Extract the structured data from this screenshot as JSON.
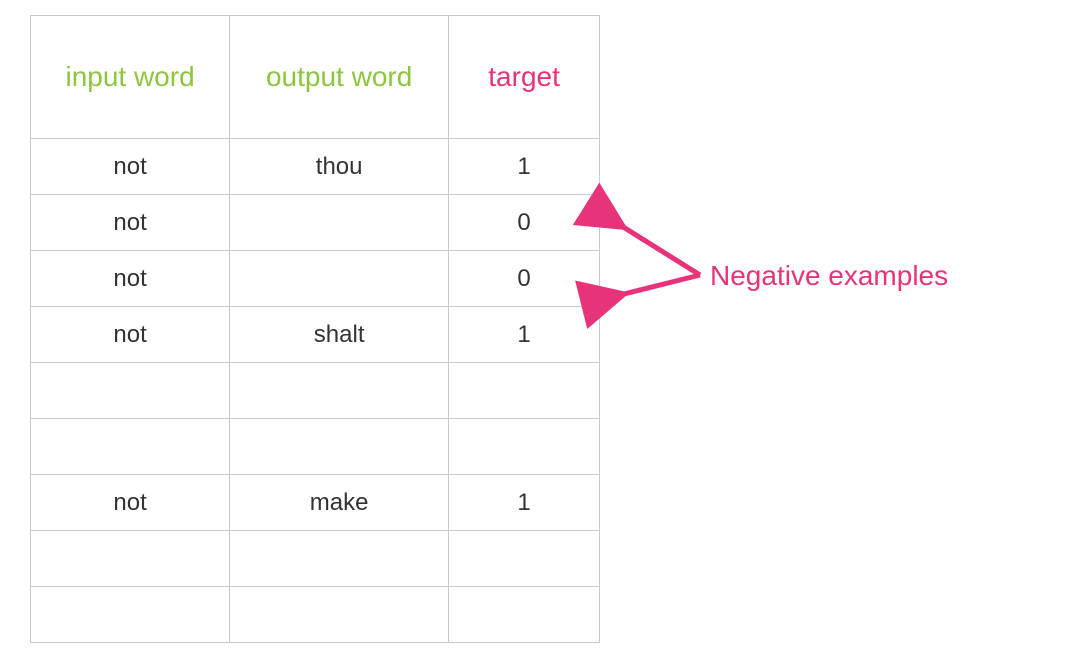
{
  "columns": {
    "input": "input word",
    "output": "output word",
    "target": "target"
  },
  "rows": [
    {
      "input": "not",
      "output": "thou",
      "target": "1"
    },
    {
      "input": "not",
      "output": "",
      "target": "0"
    },
    {
      "input": "not",
      "output": "",
      "target": "0"
    },
    {
      "input": "not",
      "output": "shalt",
      "target": "1"
    },
    {
      "input": "",
      "output": "",
      "target": ""
    },
    {
      "input": "",
      "output": "",
      "target": ""
    },
    {
      "input": "not",
      "output": "make",
      "target": "1"
    },
    {
      "input": "",
      "output": "",
      "target": ""
    },
    {
      "input": "",
      "output": "",
      "target": ""
    }
  ],
  "annotation": "Negative examples",
  "colors": {
    "green": "#8cc63f",
    "pink": "#e6337a",
    "border": "#c9c9c9"
  }
}
